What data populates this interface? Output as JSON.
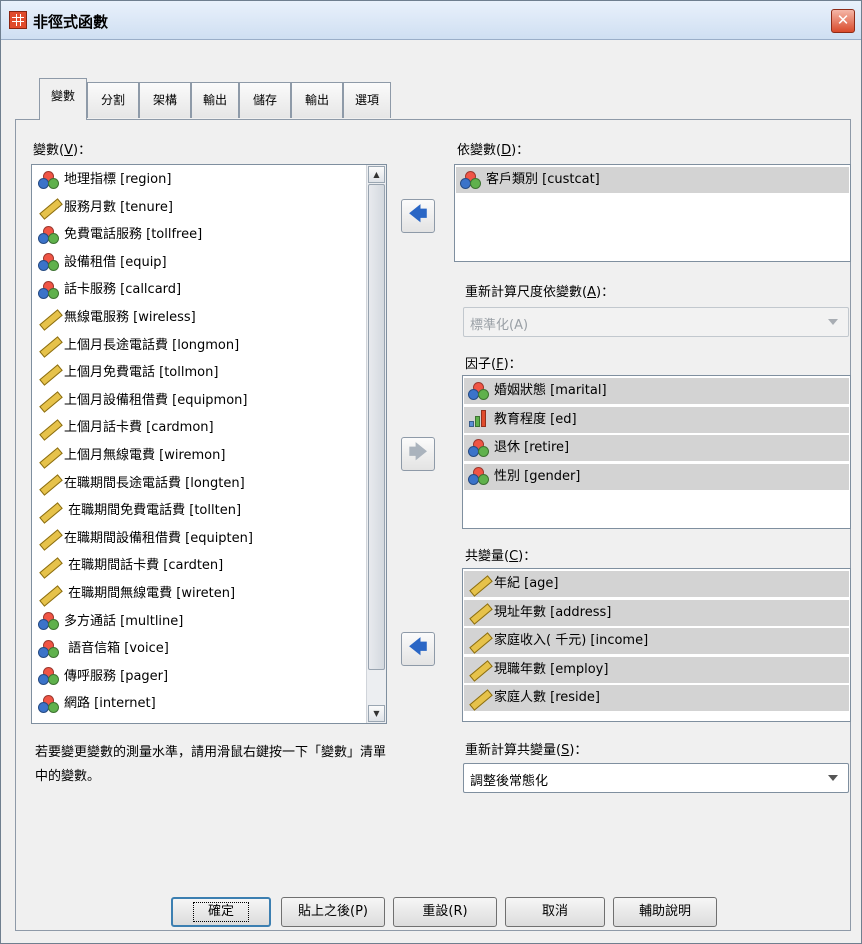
{
  "window": {
    "title": "非徑式函數",
    "close_glyph": "✕"
  },
  "tabs": [
    {
      "label": "變數"
    },
    {
      "label": "分割"
    },
    {
      "label": "架構"
    },
    {
      "label": "輸出"
    },
    {
      "label": "儲存"
    },
    {
      "label": "輸出"
    },
    {
      "label": "選項"
    }
  ],
  "variables": {
    "label": "變數",
    "mnemonic": "V",
    "items": [
      {
        "label": "地理指標 [region]",
        "type": "nominal"
      },
      {
        "label": "服務月數 [tenure]",
        "type": "scale"
      },
      {
        "label": "免費電話服務 [tollfree]",
        "type": "nominal"
      },
      {
        "label": "設備租借 [equip]",
        "type": "nominal"
      },
      {
        "label": "話卡服務 [callcard]",
        "type": "nominal"
      },
      {
        "label": "無線電服務 [wireless]",
        "type": "scale"
      },
      {
        "label": "上個月長途電話費 [longmon]",
        "type": "scale"
      },
      {
        "label": "上個月免費電話 [tollmon]",
        "type": "scale"
      },
      {
        "label": "上個月設備租借費 [equipmon]",
        "type": "scale"
      },
      {
        "label": "上個月話卡費 [cardmon]",
        "type": "scale"
      },
      {
        "label": "上個月無線電費 [wiremon]",
        "type": "scale"
      },
      {
        "label": "在職期間長途電話費 [longten]",
        "type": "scale"
      },
      {
        "label": " 在職期間免費電話費 [tollten]",
        "type": "scale"
      },
      {
        "label": "在職期間設備租借費 [equipten]",
        "type": "scale"
      },
      {
        "label": " 在職期間話卡費 [cardten]",
        "type": "scale"
      },
      {
        "label": " 在職期間無線電費 [wireten]",
        "type": "scale"
      },
      {
        "label": "多方通話 [multline]",
        "type": "nominal"
      },
      {
        "label": " 語音信箱 [voice]",
        "type": "nominal"
      },
      {
        "label": "傳呼服務 [pager]",
        "type": "nominal"
      },
      {
        "label": "網路 [internet]",
        "type": "nominal"
      }
    ]
  },
  "dependent": {
    "label": "依變數",
    "mnemonic": "D",
    "items": [
      {
        "label": "客戶類別 [custcat]",
        "type": "nominal"
      }
    ]
  },
  "rescale_dependent": {
    "label": "重新計算尺度依變數",
    "mnemonic": "A",
    "value": "標準化(A)"
  },
  "factors": {
    "label": "因子",
    "mnemonic": "F",
    "items": [
      {
        "label": "婚姻狀態 [marital]",
        "type": "nominal"
      },
      {
        "label": "教育程度 [ed]",
        "type": "ordinal"
      },
      {
        "label": "退休    [retire]",
        "type": "nominal"
      },
      {
        "label": "性別 [gender]",
        "type": "nominal"
      }
    ]
  },
  "covariates": {
    "label": "共變量",
    "mnemonic": "C",
    "items": [
      {
        "label": "年紀 [age]",
        "type": "scale"
      },
      {
        "label": "現址年數 [address]",
        "type": "scale"
      },
      {
        "label": "家庭收入( 千元) [income]",
        "type": "scale"
      },
      {
        "label": "現職年數 [employ]",
        "type": "scale"
      },
      {
        "label": "家庭人數 [reside]",
        "type": "scale"
      }
    ]
  },
  "rescale_covariates": {
    "label": "重新計算共變量",
    "mnemonic": "S",
    "value": "調整後常態化"
  },
  "hint": "若要變更變數的測量水準，請用滑鼠右鍵按一下「變數」清單中的變數。",
  "arrows": {
    "dependent": "🡄",
    "factors": "🡆",
    "covariates": "🡄"
  },
  "buttons": {
    "ok": "確定",
    "paste": "貼上之後(P)",
    "reset": "重設(R)",
    "cancel": "取消",
    "help": "輔助說明"
  }
}
